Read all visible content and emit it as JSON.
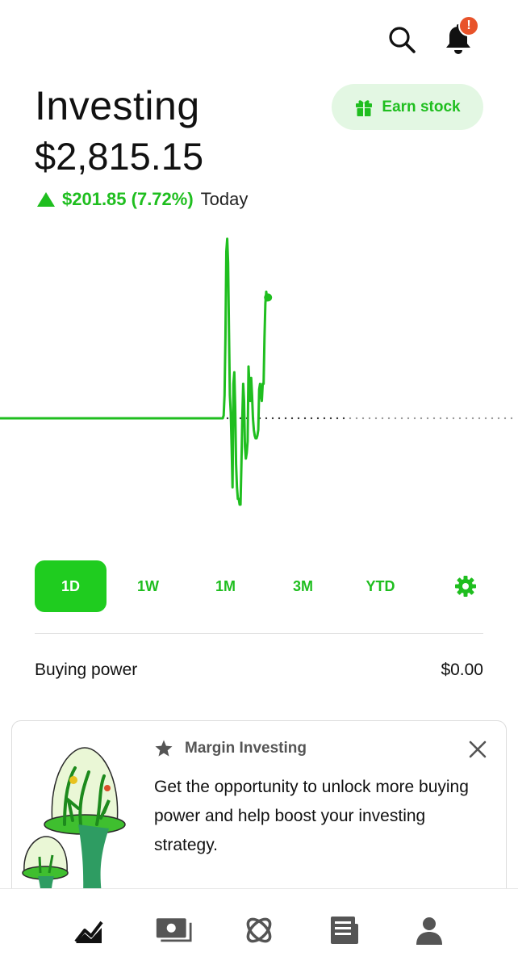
{
  "header": {
    "title": "Investing",
    "balance": "$2,815.15",
    "change": {
      "value": "$201.85 (7.72%)",
      "label": "Today",
      "direction": "up"
    },
    "notification_badge": "!",
    "earn_button": {
      "label": "Earn stock",
      "icon": "gift-icon"
    }
  },
  "colors": {
    "accent": "#1fbe1f",
    "active_bg": "#1fcc1f",
    "earn_bg": "#e3f7e3",
    "badge": "#e8532a"
  },
  "chart_data": {
    "type": "line",
    "series": [
      {
        "values": [
          0,
          0,
          0,
          0,
          0,
          0,
          0,
          0,
          0,
          0,
          0,
          0,
          0,
          0,
          0,
          0,
          0,
          0,
          0,
          0,
          0,
          0,
          0,
          0,
          0,
          0,
          0,
          0,
          0,
          0,
          0,
          0,
          0,
          0,
          0,
          0,
          0,
          0,
          0,
          0,
          0,
          0,
          0,
          0,
          0,
          0,
          0,
          0,
          0,
          0,
          0,
          0,
          0,
          0,
          0,
          0,
          0,
          0,
          0,
          0,
          0,
          0,
          0,
          0,
          0,
          0,
          0,
          0,
          0,
          0,
          0,
          0,
          0,
          0,
          0,
          0,
          0,
          0,
          0,
          0,
          0,
          0,
          0,
          0,
          0,
          0,
          0,
          0,
          0,
          0,
          0,
          0,
          0,
          0,
          0,
          0,
          0,
          0,
          0,
          0,
          0,
          0,
          0,
          0,
          0,
          0,
          0,
          0,
          0,
          0,
          0,
          0,
          0,
          0,
          0,
          0,
          0,
          0,
          0,
          0,
          0,
          0,
          0,
          0,
          0,
          0,
          0,
          0,
          0,
          0,
          0,
          0,
          0,
          0,
          0,
          0,
          0,
          0,
          0,
          0,
          0,
          0,
          0,
          0,
          0,
          0,
          0,
          0,
          0,
          0,
          0,
          0,
          0,
          0,
          0,
          0,
          0,
          0,
          0,
          0,
          0,
          0,
          0,
          0,
          0,
          0,
          0,
          0,
          0,
          0,
          0,
          0,
          0,
          0,
          0,
          0,
          0,
          0,
          0,
          0,
          0,
          0,
          0,
          0,
          0,
          0,
          0,
          0,
          0,
          0,
          0,
          0,
          0,
          0,
          0,
          0,
          0,
          0,
          0,
          0,
          0,
          0,
          0,
          0,
          0,
          0,
          0,
          0,
          0,
          0,
          0,
          0,
          0,
          0,
          0,
          0,
          0,
          0,
          0,
          0,
          0,
          0,
          0,
          0,
          0,
          0,
          0,
          0,
          0,
          0,
          0,
          0,
          0,
          0,
          0,
          0,
          0,
          0,
          0,
          0,
          0,
          0,
          0,
          0,
          0,
          0,
          0,
          0,
          0,
          0,
          0,
          0,
          5,
          40,
          140,
          290,
          312,
          270,
          150,
          40,
          10,
          -50,
          -120,
          60,
          80,
          20,
          -80,
          -120,
          -140,
          -140,
          -150,
          -150,
          -80,
          0,
          60,
          30,
          -50,
          -70,
          -60,
          -40,
          90,
          60,
          30,
          70,
          40,
          0,
          -20,
          -30,
          -35,
          -35,
          -30,
          -20,
          50,
          60,
          40,
          30,
          60,
          60,
          140,
          200,
          220,
          205,
          210
        ]
      }
    ],
    "baseline": 0,
    "current_value": 201.85,
    "baseline_style": "dotted"
  },
  "ranges": {
    "items": [
      {
        "label": "1D",
        "active": true
      },
      {
        "label": "1W",
        "active": false
      },
      {
        "label": "1M",
        "active": false
      },
      {
        "label": "3M",
        "active": false
      },
      {
        "label": "YTD",
        "active": false
      }
    ],
    "settings_icon": "gear-icon"
  },
  "buying_power": {
    "label": "Buying power",
    "value": "$0.00"
  },
  "promo_card": {
    "title": "Margin Investing",
    "title_icon": "star-icon",
    "body": "Get the opportunity to unlock more buying power and help boost your investing strategy.",
    "close_icon": "close-icon",
    "illustration": "terrarium-illustration"
  },
  "bottom_nav": [
    {
      "icon": "chart-icon",
      "active": true
    },
    {
      "icon": "cash-icon",
      "active": false
    },
    {
      "icon": "crypto-icon",
      "active": false
    },
    {
      "icon": "news-icon",
      "active": false
    },
    {
      "icon": "account-icon",
      "active": false
    }
  ]
}
